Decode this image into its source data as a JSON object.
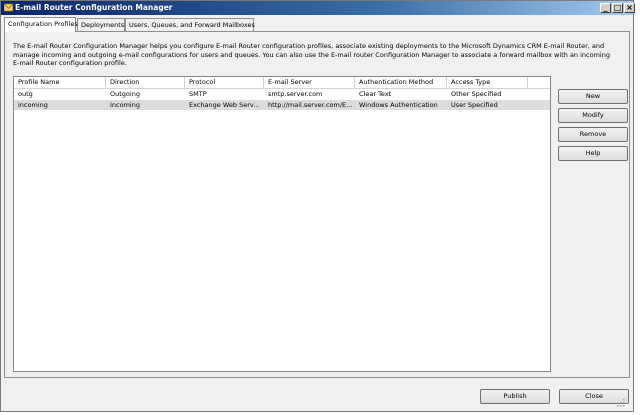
{
  "window": {
    "title": "E-mail Router Configuration Manager",
    "min": "_",
    "max": "□",
    "close": "×"
  },
  "tabs": [
    "Configuration Profiles",
    "Deployments",
    "Users, Queues, and Forward Mailboxes"
  ],
  "description": "The E-mail Router Configuration Manager helps you configure E-mail Router configuration profiles, associate existing deployments to the Microsoft Dynamics CRM E-mail Router, and manage incoming and outgoing e-mail configurations for users and queues. You can also use the E-mail router Configuration Manager to associate a forward mailbox with an incoming E-mail Router configuration profile.",
  "table": {
    "columns": [
      "Profile Name",
      "Direction",
      "Protocol",
      "E-mail Server",
      "Authentication Method",
      "Access Type"
    ],
    "rows": [
      [
        "outg",
        "Outgoing",
        "SMTP",
        "smtp.server.com",
        "Clear Text",
        "Other Specified"
      ],
      [
        "incoming",
        "Incoming",
        "Exchange Web Serv...",
        "http://mail.server.com/E...",
        "Windows Authentication",
        "User Specified"
      ]
    ]
  },
  "side_buttons": {
    "new": "New",
    "modify": "Modify",
    "remove": "Remove",
    "help": "Help"
  },
  "footer": {
    "publish": "Publish",
    "close": "Close"
  }
}
